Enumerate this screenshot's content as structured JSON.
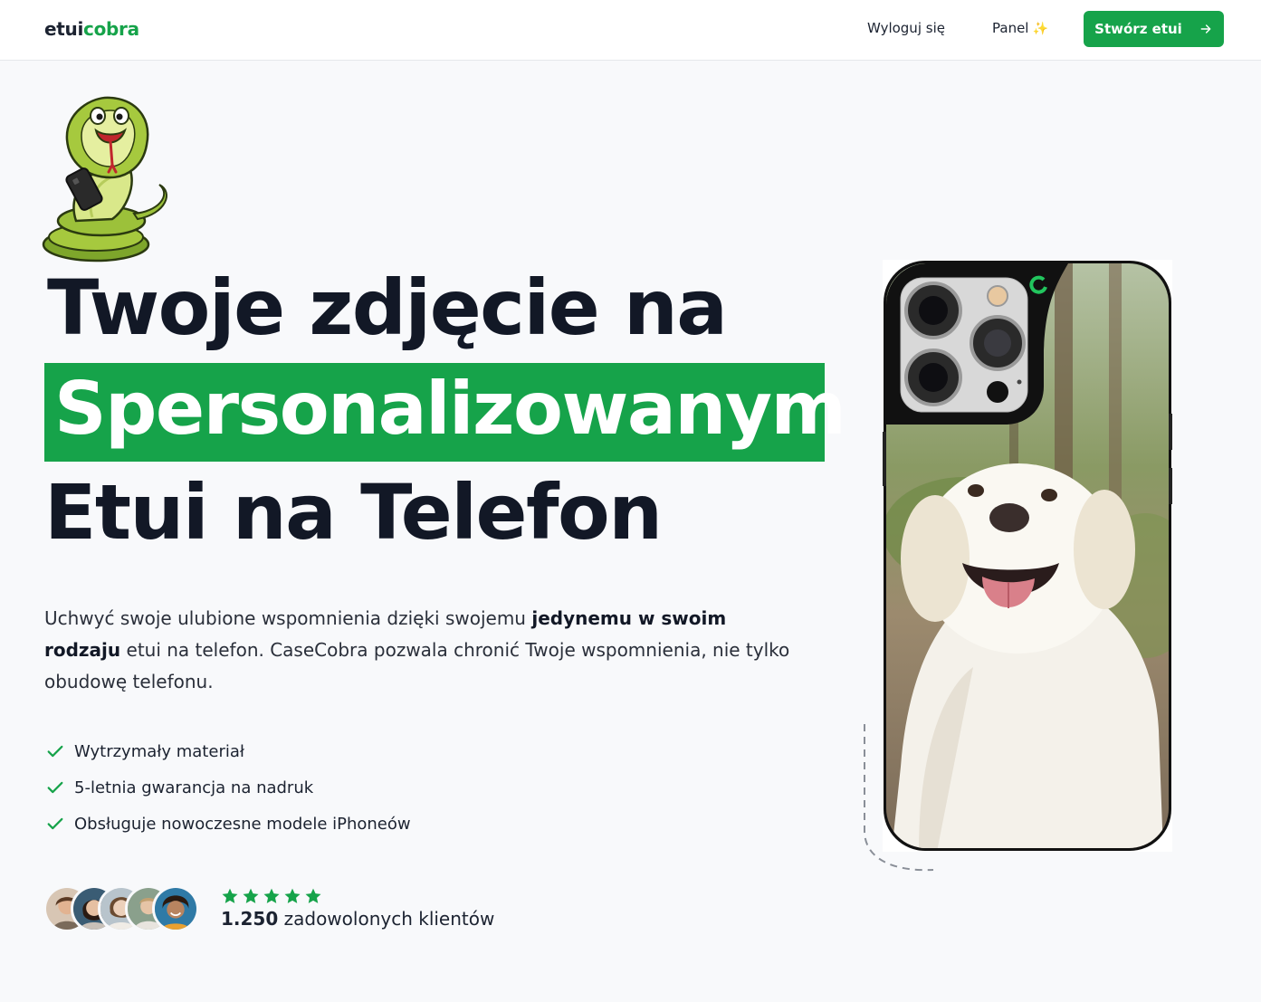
{
  "header": {
    "logo_part1": "etui",
    "logo_part2": "cobra",
    "logout_label": "Wyloguj się",
    "panel_label": "Panel",
    "panel_icon": "sparkle-icon",
    "cta_label": "Stwórz etui",
    "cta_icon": "arrow-right-icon"
  },
  "hero": {
    "headline_line1": "Twoje zdjęcie na",
    "headline_highlight": "Spersonalizowanym",
    "headline_line3": "Etui na Telefon",
    "lead_part1": "Uchwyć swoje ulubione wspomnienia dzięki swojemu ",
    "lead_bold": "jedynemu w swoim rodzaju",
    "lead_part2": " etui na telefon. CaseCobra pozwala chronić Twoje wspomnienia, nie tylko obudowę telefonu.",
    "features": [
      "Wytrzymały materiał",
      "5-letnia gwarancja na nadruk",
      "Obsługuje nowoczesne modele iPhoneów"
    ],
    "rating_stars": 5,
    "customers_count": "1.250",
    "customers_text": "zadowolonych klientów"
  },
  "colors": {
    "accent": "#16a34a",
    "heading": "#121826",
    "background": "#f8f9fb"
  }
}
